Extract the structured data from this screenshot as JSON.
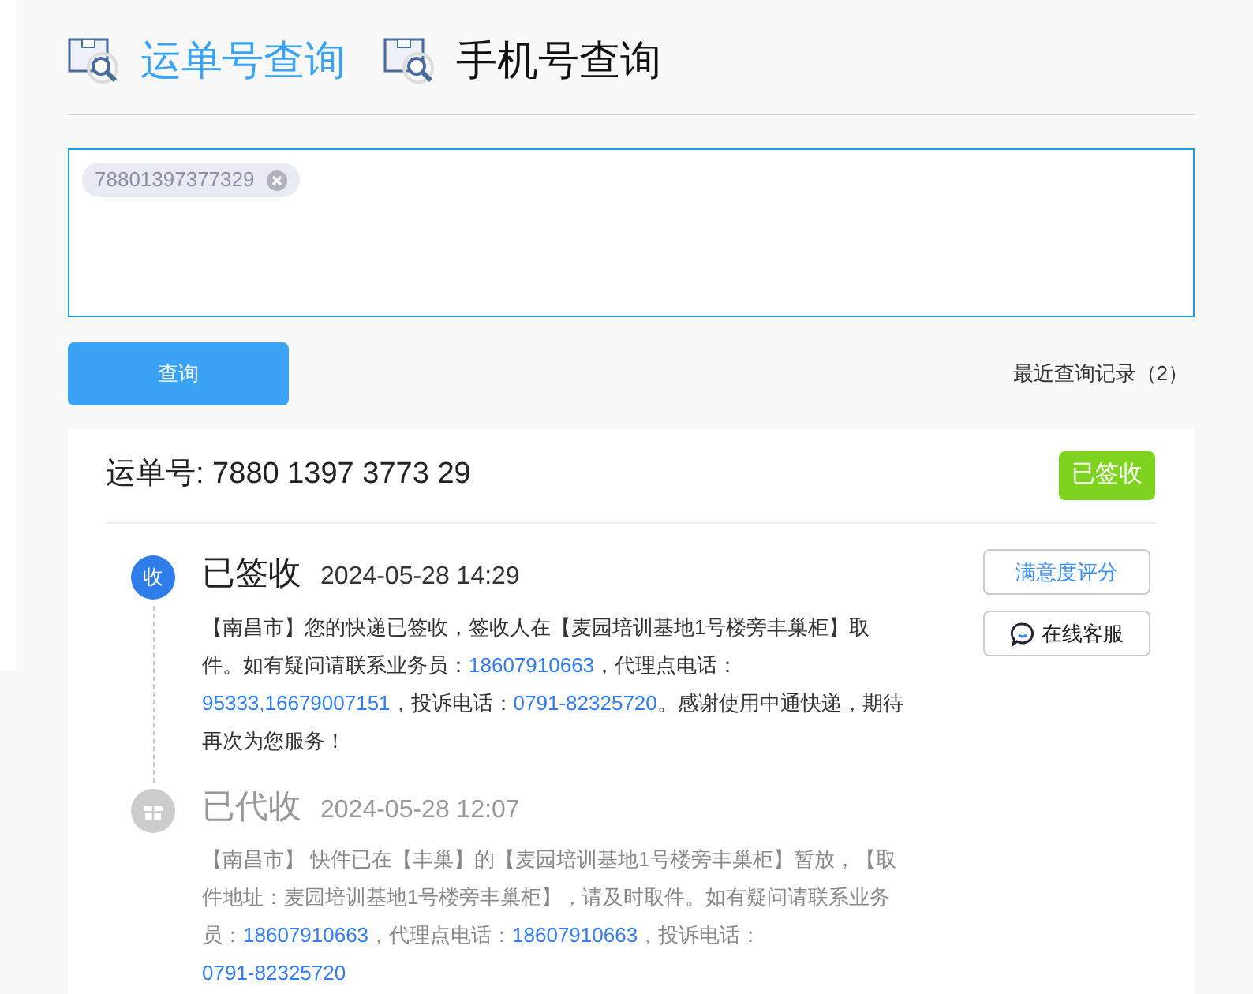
{
  "tabs": [
    {
      "label": "运单号查询",
      "selected": true
    },
    {
      "label": "手机号查询",
      "selected": false
    }
  ],
  "input": {
    "tags": [
      "78801397377329"
    ]
  },
  "query_button": "查询",
  "history_link": "最近查询记录（2）",
  "result": {
    "waybill": "运单号: 7880 1397 3773 29",
    "status_badge": "已签收",
    "events": [
      {
        "kind": "signed",
        "icon_label": "收",
        "title": "已签收",
        "time": "2024-05-28 14:29",
        "latest": true,
        "description": [
          {
            "kind": "text",
            "text": "【南昌市】您的快递已签收，签收人在【麦园培训基地1号楼旁丰巢柜】取件。如有疑问请联系业务员："
          },
          {
            "kind": "phone",
            "text": "18607910663"
          },
          {
            "kind": "text",
            "text": "，代理点电话："
          },
          {
            "kind": "phone",
            "text": "95333,16679007151"
          },
          {
            "kind": "text",
            "text": "，投诉电话："
          },
          {
            "kind": "phone",
            "text": "0791-82325720"
          },
          {
            "kind": "text",
            "text": "。感谢使用中通快递，期待再次为您服务！"
          }
        ],
        "actions": [
          {
            "kind": "rate",
            "label": "满意度评分"
          },
          {
            "kind": "chat",
            "label": "在线客服"
          }
        ]
      },
      {
        "kind": "stored",
        "title": "已代收",
        "time": "2024-05-28 12:07",
        "latest": false,
        "description": [
          {
            "kind": "text",
            "text": "【南昌市】 快件已在【丰巢】的【麦园培训基地1号楼旁丰巢柜】暂放，【取件地址：麦园培训基地1号楼旁丰巢柜】，请及时取件。如有疑问请联系业务员："
          },
          {
            "kind": "phone",
            "text": "18607910663"
          },
          {
            "kind": "text",
            "text": "，代理点电话："
          },
          {
            "kind": "phone",
            "text": "18607910663"
          },
          {
            "kind": "text",
            "text": "，投诉电话："
          },
          {
            "kind": "phone",
            "text": "0791-82325720"
          }
        ]
      }
    ]
  }
}
